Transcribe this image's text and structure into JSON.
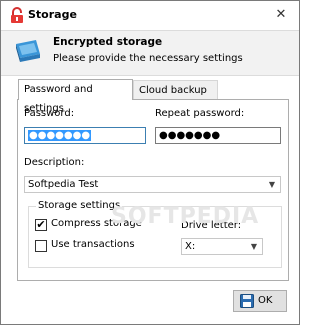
{
  "window": {
    "title": "Storage",
    "close_glyph": "✕"
  },
  "header": {
    "title": "Encrypted storage",
    "subtitle": "Please provide the necessary settings",
    "icon": "hard-drive-icon"
  },
  "tabs": [
    {
      "label": "Password and settings",
      "active": true
    },
    {
      "label": "Cloud backup",
      "active": false
    }
  ],
  "form": {
    "password_label": "Password:",
    "password_value": "●●●●●●●",
    "repeat_label": "Repeat password:",
    "repeat_value": "●●●●●●●",
    "description_label": "Description:",
    "description_value": "Softpedia Test",
    "storage_group_title": "Storage settings",
    "compress_label": "Compress storage",
    "compress_checked": true,
    "transactions_label": "Use transactions",
    "transactions_checked": false,
    "drive_label": "Drive letter:",
    "drive_value": "X:"
  },
  "buttons": {
    "ok_label": "OK"
  },
  "watermark": "SOFTPEDIA",
  "colors": {
    "accent": "#3399ff",
    "lock_red": "#d32f2f"
  }
}
